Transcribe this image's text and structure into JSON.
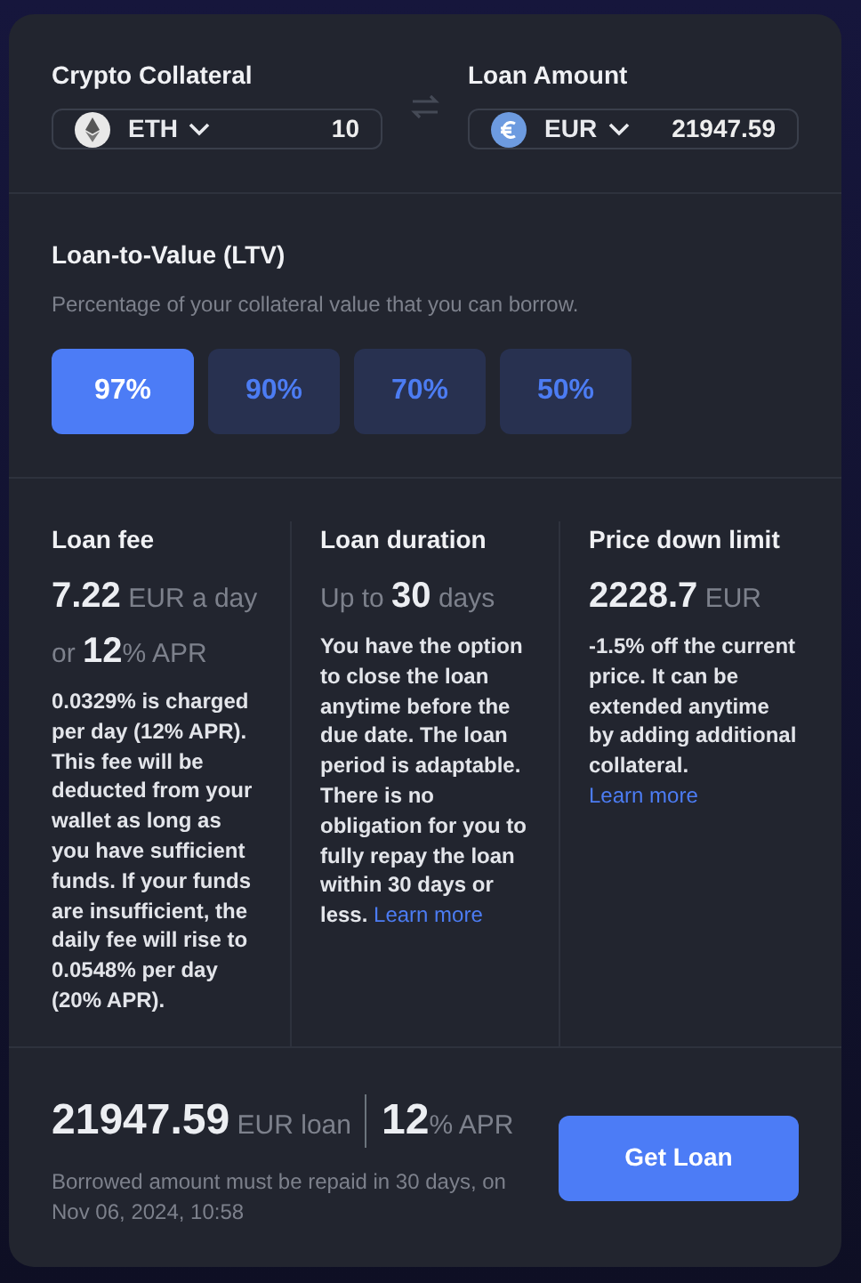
{
  "collateral": {
    "label": "Crypto Collateral",
    "currency": "ETH",
    "amount": "10"
  },
  "loan": {
    "label": "Loan Amount",
    "currency": "EUR",
    "amount": "21947.59"
  },
  "ltv": {
    "title": "Loan-to-Value (LTV)",
    "subtitle": "Percentage of your collateral value that you can borrow.",
    "options": [
      {
        "label": "97%",
        "selected": true
      },
      {
        "label": "90%",
        "selected": false
      },
      {
        "label": "70%",
        "selected": false
      },
      {
        "label": "50%",
        "selected": false
      }
    ]
  },
  "details": [
    {
      "title": "Loan fee",
      "value": "**7.22** EUR a day or **12**% APR",
      "description": "0.0329% is charged per day (12% APR). This fee will be deducted from your wallet as long as you have sufficient funds. If your funds are insufficient, the daily fee will rise to 0.0548% per day (20% APR)."
    },
    {
      "title": "Loan duration",
      "value": "Up to **30** days",
      "description": "You have the option to close the loan anytime before the due date. The loan period is adaptable. There is no obligation for you to fully repay the loan within 30 days or less.",
      "link": "Learn more"
    },
    {
      "title": "Price down limit",
      "value": "**2228.7** EUR",
      "description": "**-1.5%** off the current price. It can be extended anytime by adding additional collateral.",
      "link": "Learn more"
    }
  ],
  "summary": {
    "amount": "**21947.59** EUR loan",
    "apr": "**12**% APR",
    "note": "Borrowed amount must be repaid in 30 days, on Nov 06, 2024, 10:58",
    "button": "Get Loan"
  }
}
